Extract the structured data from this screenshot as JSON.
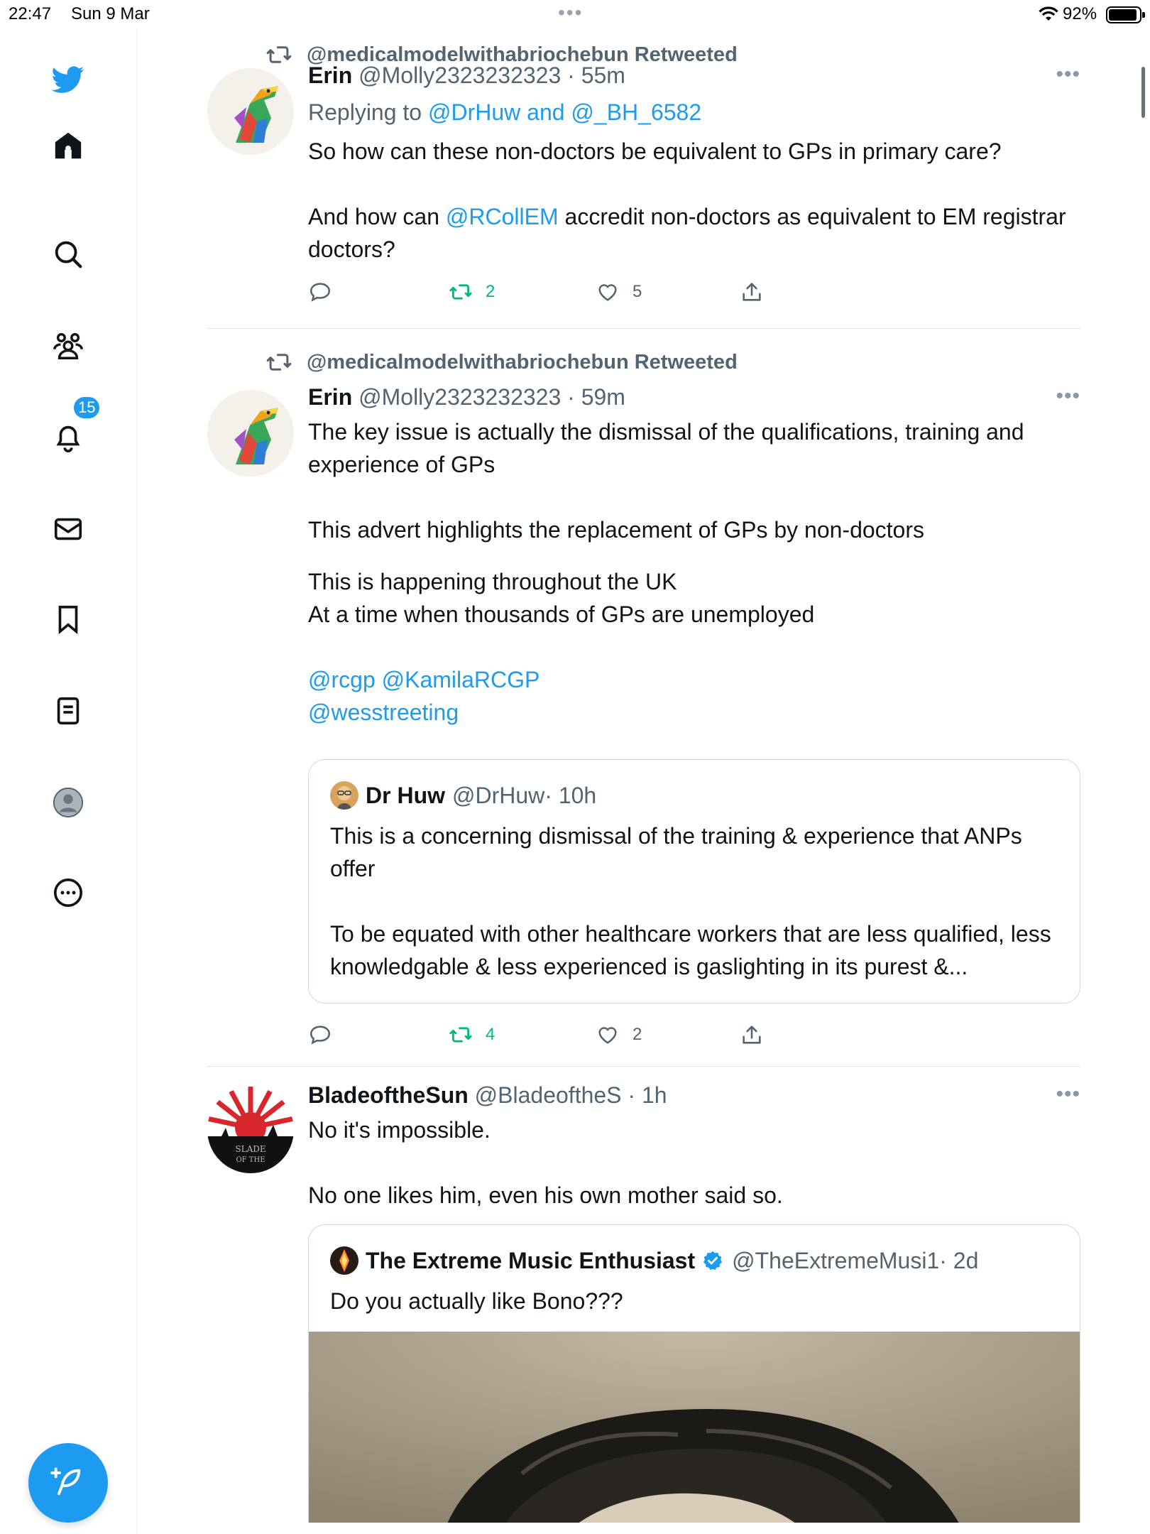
{
  "status_bar": {
    "time": "22:47",
    "date": "Sun 9 Mar",
    "battery_pct": "92%",
    "battery_level": 0.92
  },
  "sidebar": {
    "notifications_badge": "15",
    "items": [
      "twitter-logo",
      "home-icon",
      "search-icon",
      "communities-icon",
      "notifications-icon",
      "messages-icon",
      "bookmarks-icon",
      "lists-icon",
      "profile-icon",
      "more-icon"
    ]
  },
  "colors": {
    "accent": "#1d9bf0",
    "retweet_green": "#00ba7c",
    "muted": "#536471"
  },
  "tweets": [
    {
      "retweeted_by": "@medicalmodelwithabriochebun Retweeted",
      "name": "Erin",
      "handle": "@Molly2323232323",
      "time": "· 55m",
      "replying_label": "Replying to",
      "replying_to": "@DrHuw and @_BH_6582",
      "p1": "So how can these non-doctors be equivalent to GPs in primary care?",
      "p2_pre": "And how can",
      "p2_mention": "@RCollEM",
      "p2_post": "accredit non-doctors as equivalent to EM registrar doctors?",
      "retweets": "2",
      "likes": "5"
    },
    {
      "retweeted_by": "@medicalmodelwithabriochebun Retweeted",
      "name": "Erin",
      "handle": "@Molly2323232323",
      "time": "· 59m",
      "p1": "The key issue is actually the dismissal of the qualifications, training and experience of GPs",
      "p2": "This advert highlights the replacement of GPs by non-doctors",
      "p3a": "This is happening throughout the UK",
      "p3b": "At a time when thousands of GPs are unemployed",
      "mentions1": "@rcgp @KamilaRCGP",
      "mentions2": "@wesstreeting",
      "quote": {
        "name": "Dr Huw",
        "handle": "@DrHuw",
        "time": "· 10h",
        "p1": "This is a concerning dismissal of the training & experience that ANPs offer",
        "p2": "To be equated with other healthcare workers that are less qualified, less knowledgable & less experienced is gaslighting in its purest &..."
      },
      "retweets": "4",
      "likes": "2"
    },
    {
      "name": "BladeoftheSun",
      "handle": "@BladeoftheS",
      "time": "· 1h",
      "p1": "No it's impossible.",
      "p2": "No one likes him, even his own mother said so.",
      "avatar_text": "SLADE OF THE",
      "quote": {
        "name": "The Extreme Music Enthusiast",
        "handle": "@TheExtremeMusi1",
        "time": "· 2d",
        "p1": "Do you actually like Bono???"
      }
    }
  ]
}
